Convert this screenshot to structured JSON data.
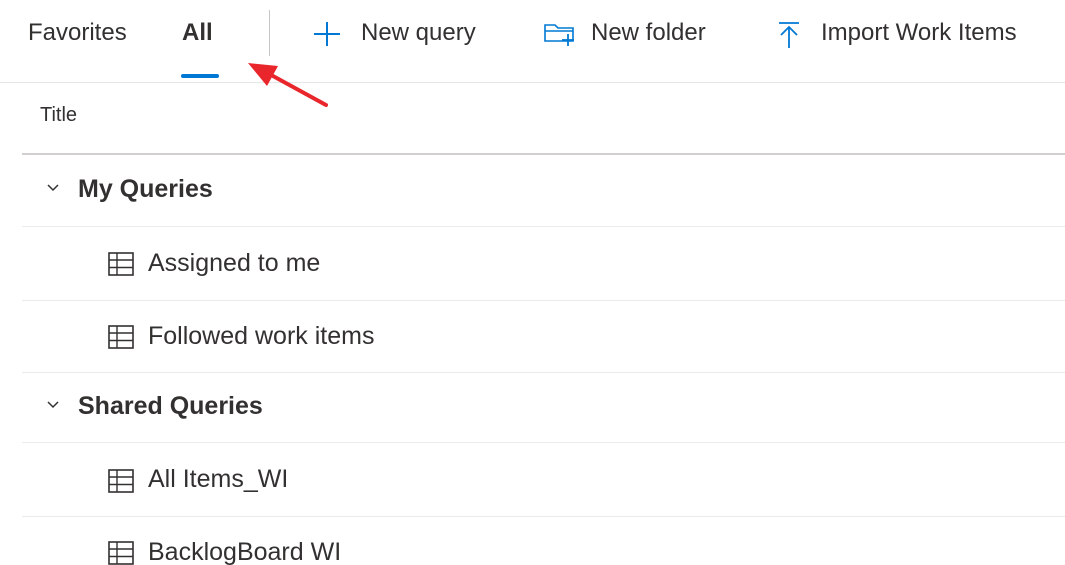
{
  "tabs": [
    {
      "label": "Favorites",
      "selected": false
    },
    {
      "label": "All",
      "selected": true
    }
  ],
  "commands": {
    "new_query": {
      "label": "New query",
      "icon": "plus-icon"
    },
    "new_folder": {
      "label": "New folder",
      "icon": "new-folder-icon"
    },
    "import": {
      "label": "Import Work Items",
      "icon": "upload-icon"
    }
  },
  "table": {
    "column_title": "Title",
    "groups": [
      {
        "label": "My Queries",
        "icon": "chevron-down-icon",
        "items": [
          {
            "label": "Assigned to me",
            "icon": "query-table-icon"
          },
          {
            "label": "Followed work items",
            "icon": "query-table-icon"
          }
        ]
      },
      {
        "label": "Shared Queries",
        "icon": "chevron-down-icon",
        "items": [
          {
            "label": "All Items_WI",
            "icon": "query-table-icon"
          },
          {
            "label": "BacklogBoard WI",
            "icon": "query-table-icon"
          }
        ]
      }
    ]
  },
  "colors": {
    "accent": "#0078d4",
    "annotation_arrow": "#e8262b"
  }
}
